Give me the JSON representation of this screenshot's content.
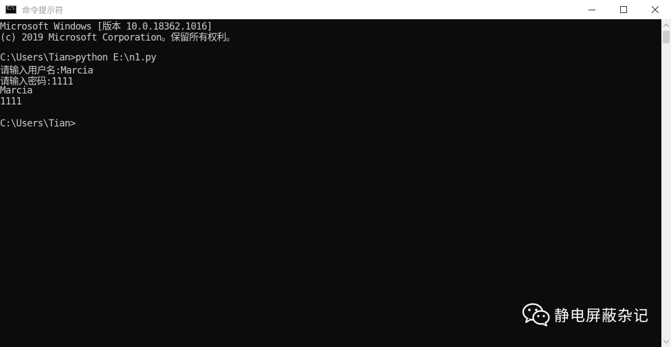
{
  "window": {
    "title": "命令提示符",
    "controls": {
      "minimize": "minimize-icon",
      "maximize": "maximize-icon",
      "close": "close-icon"
    }
  },
  "console": {
    "lines": [
      "Microsoft Windows [版本 10.0.18362.1016]",
      "(c) 2019 Microsoft Corporation。保留所有权利。",
      "",
      "C:\\Users\\Tian>python E:\\n1.py",
      "请输入用户名:Marcia",
      "请输入密码:1111",
      "Marcia",
      "1111",
      "",
      "C:\\Users\\Tian>"
    ]
  },
  "watermark": {
    "text": "静电屏蔽杂记",
    "icon": "wechat-icon"
  },
  "colors": {
    "console_bg": "#0c0c0c",
    "console_fg": "#cccccc",
    "titlebar_bg": "#ffffff",
    "title_fg": "#999999",
    "scrollbar_bg": "#f0f0f0",
    "scrollbar_thumb": "#cdcdcd"
  }
}
